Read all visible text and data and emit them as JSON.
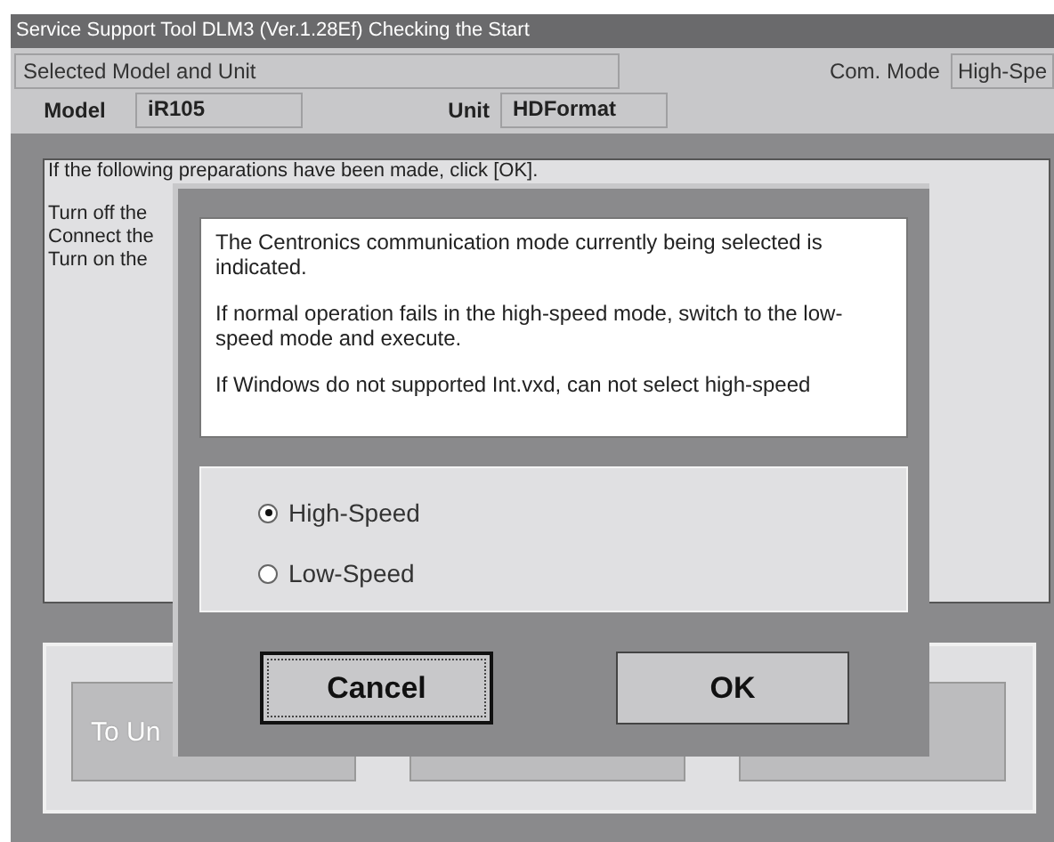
{
  "window": {
    "title": "Service Support Tool DLM3 (Ver.1.28Ef) Checking the Start"
  },
  "header": {
    "section_label": "Selected Model and Unit",
    "com_mode_label": "Com. Mode",
    "com_mode_value": "High-Spe",
    "model_label": "Model",
    "model_value": "iR105",
    "unit_label": "Unit",
    "unit_value": "HDFormat"
  },
  "instructions": {
    "intro": "If the following preparations have been made, click [OK].",
    "lines": [
      "Turn off the",
      "Connect the",
      "Turn on the"
    ]
  },
  "background_buttons": [
    {
      "label": "To Un",
      "disabled": true
    },
    {
      "disabled": true
    },
    {
      "disabled": true
    }
  ],
  "dialog": {
    "message": [
      "The Centronics communication mode currently being selected is indicated.",
      "If normal operation fails in the high-speed mode, switch to the low-speed mode and execute.",
      "If Windows do not supported Int.vxd, can not select high-speed"
    ],
    "options": [
      {
        "label": "High-Speed",
        "selected": true
      },
      {
        "label": "Low-Speed",
        "selected": false
      }
    ],
    "buttons": [
      {
        "label": "Cancel",
        "focused": true
      },
      {
        "label": "OK",
        "focused": false
      }
    ]
  }
}
